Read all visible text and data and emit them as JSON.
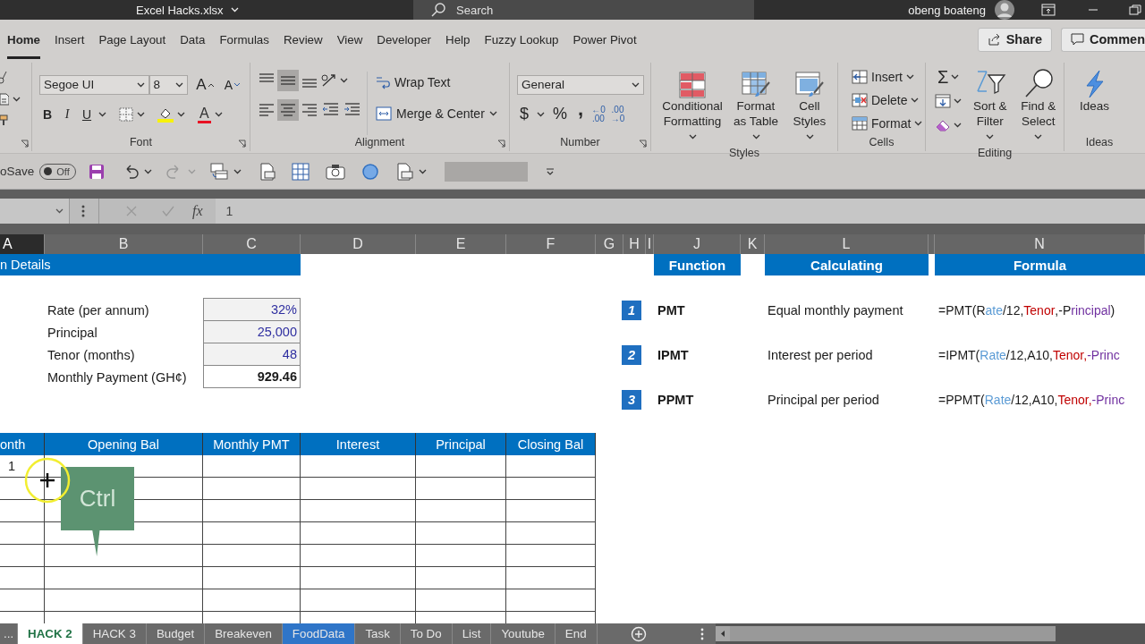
{
  "window": {
    "title": "Excel Hacks.xlsx",
    "search_placeholder": "Search",
    "user": "obeng boateng"
  },
  "ribbon_tabs": [
    {
      "label": "Home",
      "selected": true
    },
    {
      "label": "Insert",
      "selected": false
    },
    {
      "label": "Page Layout",
      "selected": false
    },
    {
      "label": "Data",
      "selected": false
    },
    {
      "label": "Formulas",
      "selected": false
    },
    {
      "label": "Review",
      "selected": false
    },
    {
      "label": "View",
      "selected": false
    },
    {
      "label": "Developer",
      "selected": false
    },
    {
      "label": "Help",
      "selected": false
    },
    {
      "label": "Fuzzy Lookup",
      "selected": false
    },
    {
      "label": "Power Pivot",
      "selected": false
    }
  ],
  "share": "Share",
  "comments": "Commen",
  "font_group": {
    "label": "Font",
    "font_name": "Segoe UI",
    "font_size": "8",
    "grow": "A",
    "shrink": "A",
    "bold": "B",
    "italic": "I",
    "underline": "U",
    "font_color": "A"
  },
  "alignment_group": {
    "label": "Alignment",
    "wrap_text": "Wrap Text",
    "merge": "Merge & Center"
  },
  "number_group": {
    "label": "Number",
    "format": "General",
    "currency": "$",
    "percent": "%",
    "comma": ",",
    "decimals": [
      {
        "top": "←0",
        "bottom": ".00"
      },
      {
        "top": ".00",
        "bottom": "→0"
      }
    ]
  },
  "styles_group": {
    "label": "Styles",
    "buttons": [
      "Conditional Formatting",
      "Format as Table",
      "Cell Styles"
    ]
  },
  "cells_group": {
    "label": "Cells",
    "buttons": [
      "Insert",
      "Delete",
      "Format"
    ]
  },
  "editing_group": {
    "label": "Editing",
    "autosum": "Σ",
    "buttons": [
      "Sort & Filter",
      "Find & Select"
    ]
  },
  "ideas_group": {
    "label": "Ideas",
    "button": "Ideas"
  },
  "quick_access": {
    "autosave_label": "oSave",
    "autosave": {
      "on": false,
      "label": "Off"
    }
  },
  "formula_bar": {
    "fx": "fx",
    "value": "1"
  },
  "columns": [
    {
      "label": "A",
      "selected": true
    },
    {
      "label": "B",
      "selected": false
    },
    {
      "label": "C",
      "selected": false
    },
    {
      "label": "D",
      "selected": false
    },
    {
      "label": "E",
      "selected": false
    },
    {
      "label": "F",
      "selected": false
    },
    {
      "label": "G",
      "selected": false
    },
    {
      "label": "H",
      "selected": false
    },
    {
      "label": "I",
      "selected": false
    },
    {
      "label": "J",
      "selected": false
    },
    {
      "label": "K",
      "selected": false
    },
    {
      "label": "L",
      "selected": false
    },
    {
      "label": "N",
      "selected": false
    }
  ],
  "loan_details": {
    "title": "n Details",
    "fields": [
      {
        "label": "Rate (per annum)",
        "value": "32%"
      },
      {
        "label": "Principal",
        "value": "25,000"
      },
      {
        "label": "Tenor (months)",
        "value": "48"
      }
    ],
    "result": {
      "label": "Monthly Payment (GH¢)",
      "value": "929.46"
    }
  },
  "functions": {
    "headers": [
      "Function",
      "Calculating",
      "Formula"
    ],
    "rows": [
      {
        "number": "1",
        "name": "PMT",
        "description": "Equal monthly payment",
        "formula": [
          {
            "text": "=PMT(R",
            "color": "#1a1a1a"
          },
          {
            "text": "ate",
            "color": "#5b9bd5"
          },
          {
            "text": "/12,",
            "color": "#1a1a1a"
          },
          {
            "text": "Tenor",
            "color": "#c00000"
          },
          {
            "text": ",-P",
            "color": "#1a1a1a"
          },
          {
            "text": "rincipal",
            "color": "#7030a0"
          },
          {
            "text": ")",
            "color": "#1a1a1a"
          }
        ]
      },
      {
        "number": "2",
        "name": "IPMT",
        "description": "Interest per period",
        "formula": [
          {
            "text": "=IPMT(",
            "color": "#1a1a1a"
          },
          {
            "text": "Rate",
            "color": "#5b9bd5"
          },
          {
            "text": "/12,A10,",
            "color": "#1a1a1a"
          },
          {
            "text": "Tenor,",
            "color": "#c00000"
          },
          {
            "text": "-Princ",
            "color": "#7030a0"
          }
        ]
      },
      {
        "number": "3",
        "name": "PPMT",
        "description": "Principal per period",
        "formula": [
          {
            "text": "=PPMT(",
            "color": "#1a1a1a"
          },
          {
            "text": "Rate",
            "color": "#5b9bd5"
          },
          {
            "text": "/12,A10,",
            "color": "#1a1a1a"
          },
          {
            "text": "Tenor,",
            "color": "#c00000"
          },
          {
            "text": "-Princ",
            "color": "#7030a0"
          }
        ]
      }
    ]
  },
  "schedule": {
    "columns": [
      "onth",
      "Opening Bal",
      "Monthly PMT",
      "Interest",
      "Principal",
      "Closing Bal"
    ],
    "rows": [
      [
        "1"
      ]
    ]
  },
  "key_overlay": {
    "text": "Ctrl"
  },
  "sheet_tabs": [
    {
      "label": "...",
      "selected": false
    },
    {
      "label": "HACK 2",
      "selected": true
    },
    {
      "label": "HACK 3",
      "selected": false
    },
    {
      "label": "Budget",
      "selected": false
    },
    {
      "label": "Breakeven",
      "selected": false
    },
    {
      "label": "FoodData",
      "selected": false,
      "color": "#2f75c8"
    },
    {
      "label": "Task",
      "selected": false
    },
    {
      "label": "To Do",
      "selected": false
    },
    {
      "label": "List",
      "selected": false
    },
    {
      "label": "Youtube",
      "selected": false
    },
    {
      "label": "End",
      "selected": false
    }
  ]
}
